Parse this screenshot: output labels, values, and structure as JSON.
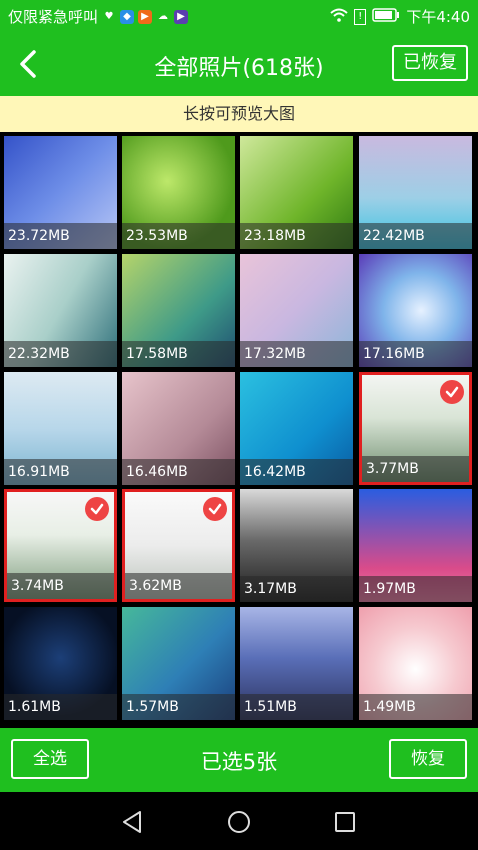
{
  "status_bar": {
    "left_text": "仅限紧急呼叫",
    "time": "下午4:40",
    "icons": [
      "heart-icon",
      "app-icon-blue",
      "app-icon-orange",
      "cloud-icon",
      "video-icon",
      "wifi-icon",
      "alert-icon",
      "battery-icon"
    ]
  },
  "header": {
    "title": "全部照片(618张)",
    "restored_button": "已恢复"
  },
  "hint": "长按可预览大图",
  "photos": [
    {
      "size": "23.72MB",
      "selected": false
    },
    {
      "size": "23.53MB",
      "selected": false
    },
    {
      "size": "23.18MB",
      "selected": false
    },
    {
      "size": "22.42MB",
      "selected": false
    },
    {
      "size": "22.32MB",
      "selected": false
    },
    {
      "size": "17.58MB",
      "selected": false
    },
    {
      "size": "17.32MB",
      "selected": false
    },
    {
      "size": "17.16MB",
      "selected": false
    },
    {
      "size": "16.91MB",
      "selected": false
    },
    {
      "size": "16.46MB",
      "selected": false
    },
    {
      "size": "16.42MB",
      "selected": false
    },
    {
      "size": "3.77MB",
      "selected": true
    },
    {
      "size": "3.74MB",
      "selected": true
    },
    {
      "size": "3.62MB",
      "selected": true
    },
    {
      "size": "3.17MB",
      "selected": false
    },
    {
      "size": "1.97MB",
      "selected": false
    },
    {
      "size": "1.61MB",
      "selected": false
    },
    {
      "size": "1.57MB",
      "selected": false
    },
    {
      "size": "1.51MB",
      "selected": false
    },
    {
      "size": "1.49MB",
      "selected": false
    }
  ],
  "footer": {
    "select_all": "全选",
    "selected_count": "已选5张",
    "recover": "恢复"
  },
  "colors": {
    "accent": "#1fbf1f",
    "hint_bg": "#fff7b8",
    "selected_border": "#e02020"
  }
}
